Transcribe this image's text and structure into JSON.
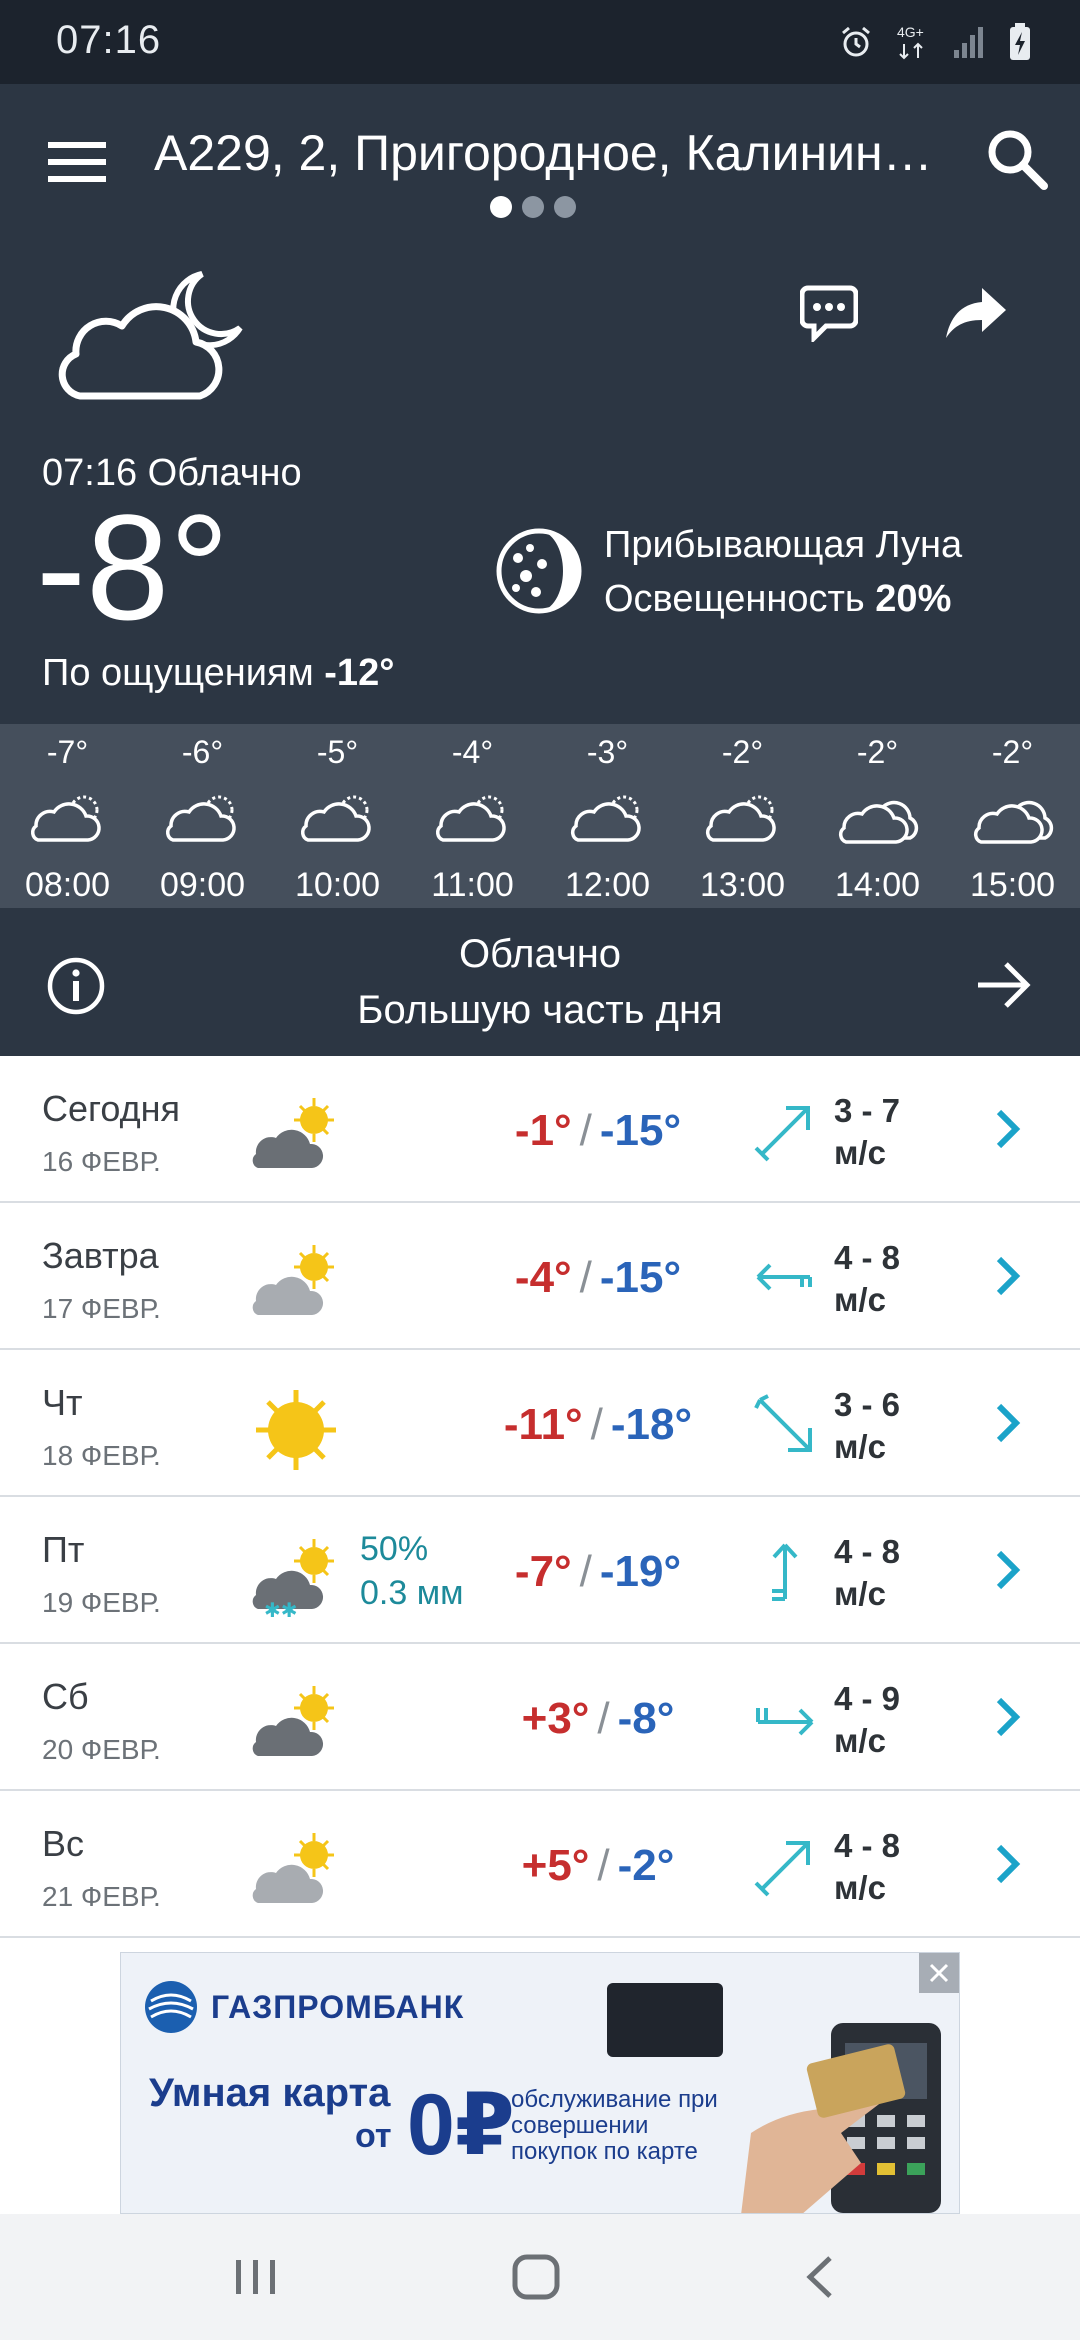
{
  "status_bar": {
    "time": "07:16",
    "icons": [
      "alarm-icon",
      "network-4g-icon",
      "signal-icon",
      "battery-charging-icon"
    ],
    "network_label": "4G+"
  },
  "header": {
    "location": "А229, 2, Пригородное, Калинин…",
    "page_count": 3,
    "active_page": 1
  },
  "current": {
    "time_condition": "07:16 Облачно",
    "temperature": "-8°",
    "feels_label": "По ощущениям",
    "feels_value": "-12°",
    "moon_phase": "Прибывающая Луна",
    "illumination_label": "Освещенность",
    "illumination_value": "20%"
  },
  "hourly": [
    {
      "temp": "-7°",
      "time": "08:00",
      "icon": "partly-cloudy-icon"
    },
    {
      "temp": "-6°",
      "time": "09:00",
      "icon": "partly-cloudy-icon"
    },
    {
      "temp": "-5°",
      "time": "10:00",
      "icon": "partly-cloudy-icon"
    },
    {
      "temp": "-4°",
      "time": "11:00",
      "icon": "partly-cloudy-icon"
    },
    {
      "temp": "-3°",
      "time": "12:00",
      "icon": "partly-cloudy-icon"
    },
    {
      "temp": "-2°",
      "time": "13:00",
      "icon": "partly-cloudy-icon"
    },
    {
      "temp": "-2°",
      "time": "14:00",
      "icon": "cloudy-icon"
    },
    {
      "temp": "-2°",
      "time": "15:00",
      "icon": "cloudy-icon"
    }
  ],
  "summary": {
    "line1": "Облачно",
    "line2": "Большую часть дня"
  },
  "daily": [
    {
      "name": "Сегодня",
      "date": "16 ФЕВР.",
      "icon": "partly-cloudy-dark-icon",
      "precip_prob": "",
      "precip_amount": "",
      "t_max": "-1°",
      "t_min": "-15°",
      "wind_icon": "wind-arrow-northeast-icon",
      "wind_speed": "3 - 7",
      "wind_unit": "м/с"
    },
    {
      "name": "Завтра",
      "date": "17 ФЕВР.",
      "icon": "partly-cloudy-light-icon",
      "precip_prob": "",
      "precip_amount": "",
      "t_max": "-4°",
      "t_min": "-15°",
      "wind_icon": "wind-arrow-west-icon",
      "wind_speed": "4 - 8",
      "wind_unit": "м/с"
    },
    {
      "name": "Чт",
      "date": "18 ФЕВР.",
      "icon": "sunny-icon",
      "precip_prob": "",
      "precip_amount": "",
      "t_max": "-11°",
      "t_min": "-18°",
      "wind_icon": "wind-arrow-southeast-icon",
      "wind_speed": "3 - 6",
      "wind_unit": "м/с"
    },
    {
      "name": "Пт",
      "date": "19 ФЕВР.",
      "icon": "partly-cloudy-snow-icon",
      "precip_prob": "50%",
      "precip_amount": "0.3 мм",
      "t_max": "-7°",
      "t_min": "-19°",
      "wind_icon": "wind-arrow-north-icon",
      "wind_speed": "4 - 8",
      "wind_unit": "м/с"
    },
    {
      "name": "Сб",
      "date": "20 ФЕВР.",
      "icon": "partly-cloudy-dark-icon",
      "precip_prob": "",
      "precip_amount": "",
      "t_max": "+3°",
      "t_min": "-8°",
      "wind_icon": "wind-arrow-east-icon",
      "wind_speed": "4 - 9",
      "wind_unit": "м/с"
    },
    {
      "name": "Вс",
      "date": "21 ФЕВР.",
      "icon": "partly-cloudy-light-icon",
      "precip_prob": "",
      "precip_amount": "",
      "t_max": "+5°",
      "t_min": "-2°",
      "wind_icon": "wind-arrow-northeast-icon",
      "wind_speed": "4 - 8",
      "wind_unit": "м/с"
    }
  ],
  "ad": {
    "brand": "ГАЗПРОМБАНК",
    "headline1": "Умная карта",
    "headline2": "от",
    "price": "0₽",
    "description": "обслуживание при совершении покупок по карте"
  },
  "colors": {
    "status_bar": "#1c232d",
    "hero_bg": "#2c3643",
    "hourly_bg": "#454f5c",
    "temp_max": "#c62e2e",
    "temp_min": "#2a64b9",
    "accent": "#1ba3c9",
    "wind_arrow": "#35b8c8",
    "sun": "#f5c518"
  }
}
